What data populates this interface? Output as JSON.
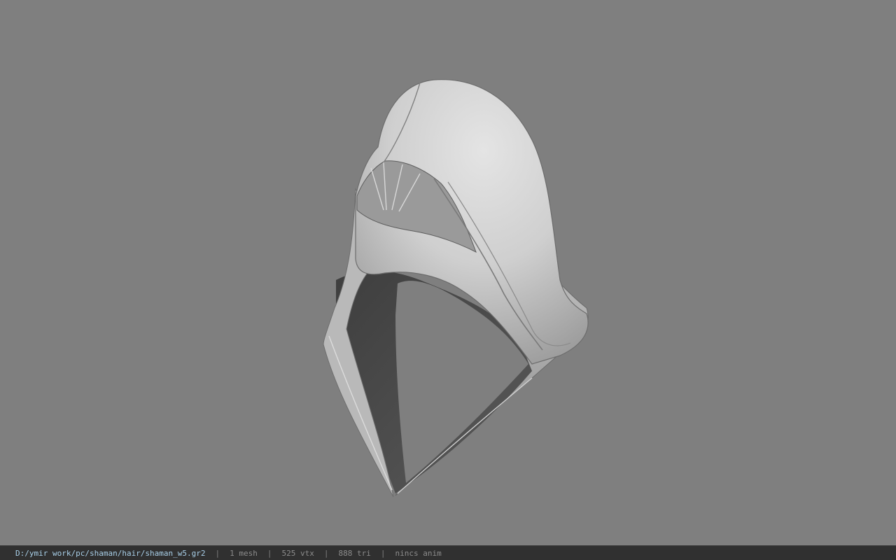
{
  "viewport": {
    "object": "hood-model",
    "background_color": "#7f7f7f"
  },
  "statusbar": {
    "file_path": "D:/ymir work/pc/shaman/hair/shaman_w5.gr2",
    "separator": "|",
    "mesh_count": "1 mesh",
    "vertex_count": "525 vtx",
    "triangle_count": "888 tri",
    "animation": "nincs anim",
    "path_color": "#a8cfe8"
  }
}
